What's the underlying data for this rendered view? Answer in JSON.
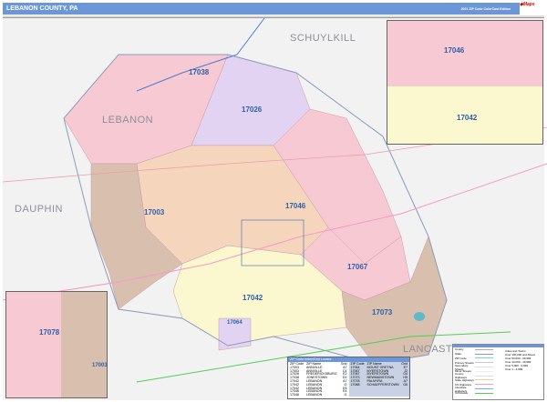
{
  "header": {
    "title": "LEBANON COUNTY, PA",
    "edition": "2021 ZIP Code ColorCast Edition",
    "logo": "Marketmaps"
  },
  "map": {
    "neighbor_labels": [
      "SCHUYLKILL",
      "LEBANON",
      "DAUPHIN",
      "LANCASTER"
    ],
    "zip_labels": [
      "17038",
      "17026",
      "17003",
      "17046",
      "17067",
      "17042",
      "17073",
      "17064"
    ],
    "inset_top_labels": [
      "17046",
      "17042"
    ],
    "inset_left_labels": [
      "17078",
      "17003"
    ],
    "colors": {
      "pink": "#f6c9d3",
      "lavender": "#e2d3f2",
      "peach": "#f6d5bd",
      "tan": "#d8bfae",
      "yellow": "#fbf7cf",
      "water": "#5fb8c9",
      "county_border": "#3366aa",
      "interstate": "#4a7dd6"
    }
  },
  "zip_index": {
    "title": "ZIP Code Index/Grid Locator",
    "headers": [
      "ZIP Code",
      "ZIP Name",
      "Grid"
    ],
    "left": [
      [
        "17003",
        "ANNVILLE",
        "A7"
      ],
      [
        "17003",
        "ANNVILLE",
        "C4"
      ],
      [
        "17026",
        "FREDERICKSBURG",
        "E2"
      ],
      [
        "17038",
        "JONESTOWN",
        "D2"
      ],
      [
        "17042",
        "LEBANON",
        "A7"
      ],
      [
        "17042",
        "LEBANON",
        "I2"
      ],
      [
        "17042",
        "LEBANON",
        "E6"
      ],
      [
        "17046",
        "LEBANON",
        "E4"
      ],
      [
        "17046",
        "LEBANON",
        "I1"
      ]
    ],
    "right": [
      [
        "17064",
        "MOUNT GRETNA",
        "E7"
      ],
      [
        "17067",
        "MYERSTOWN",
        "J2"
      ],
      [
        "17067",
        "MYERSTOWN",
        "G4"
      ],
      [
        "17073",
        "NEWMANSTOWN",
        "H5"
      ],
      [
        "17078",
        "PALMYRA",
        "A7"
      ],
      [
        "17088",
        "SCHAEFFERSTOWN",
        "G6"
      ]
    ]
  },
  "legend": {
    "items": [
      "County",
      "State",
      "ZIP Code",
      "Primary Streets",
      "Secondary Streets",
      "Minor Streets",
      "County Highways",
      "State Highways",
      "US Highways",
      "Interstate Highways",
      "Toll Roads"
    ],
    "item_colors": [
      "#aaaaaa",
      "#999999",
      "#66d9ee",
      "#cccccc",
      "#dddddd",
      "#eeeeee",
      "#dddddd",
      "#f5cfa0",
      "#f59ac8",
      "#66b8e0",
      "#55cc55"
    ],
    "cities_title": "Cities and Towns",
    "cities": [
      "Over 100,000 and Above",
      "Over 50,000 - 99,999",
      "Over 10,000 - 49,999",
      "Over 5,000 - 9,999",
      "Over 1 - 4,999"
    ]
  }
}
